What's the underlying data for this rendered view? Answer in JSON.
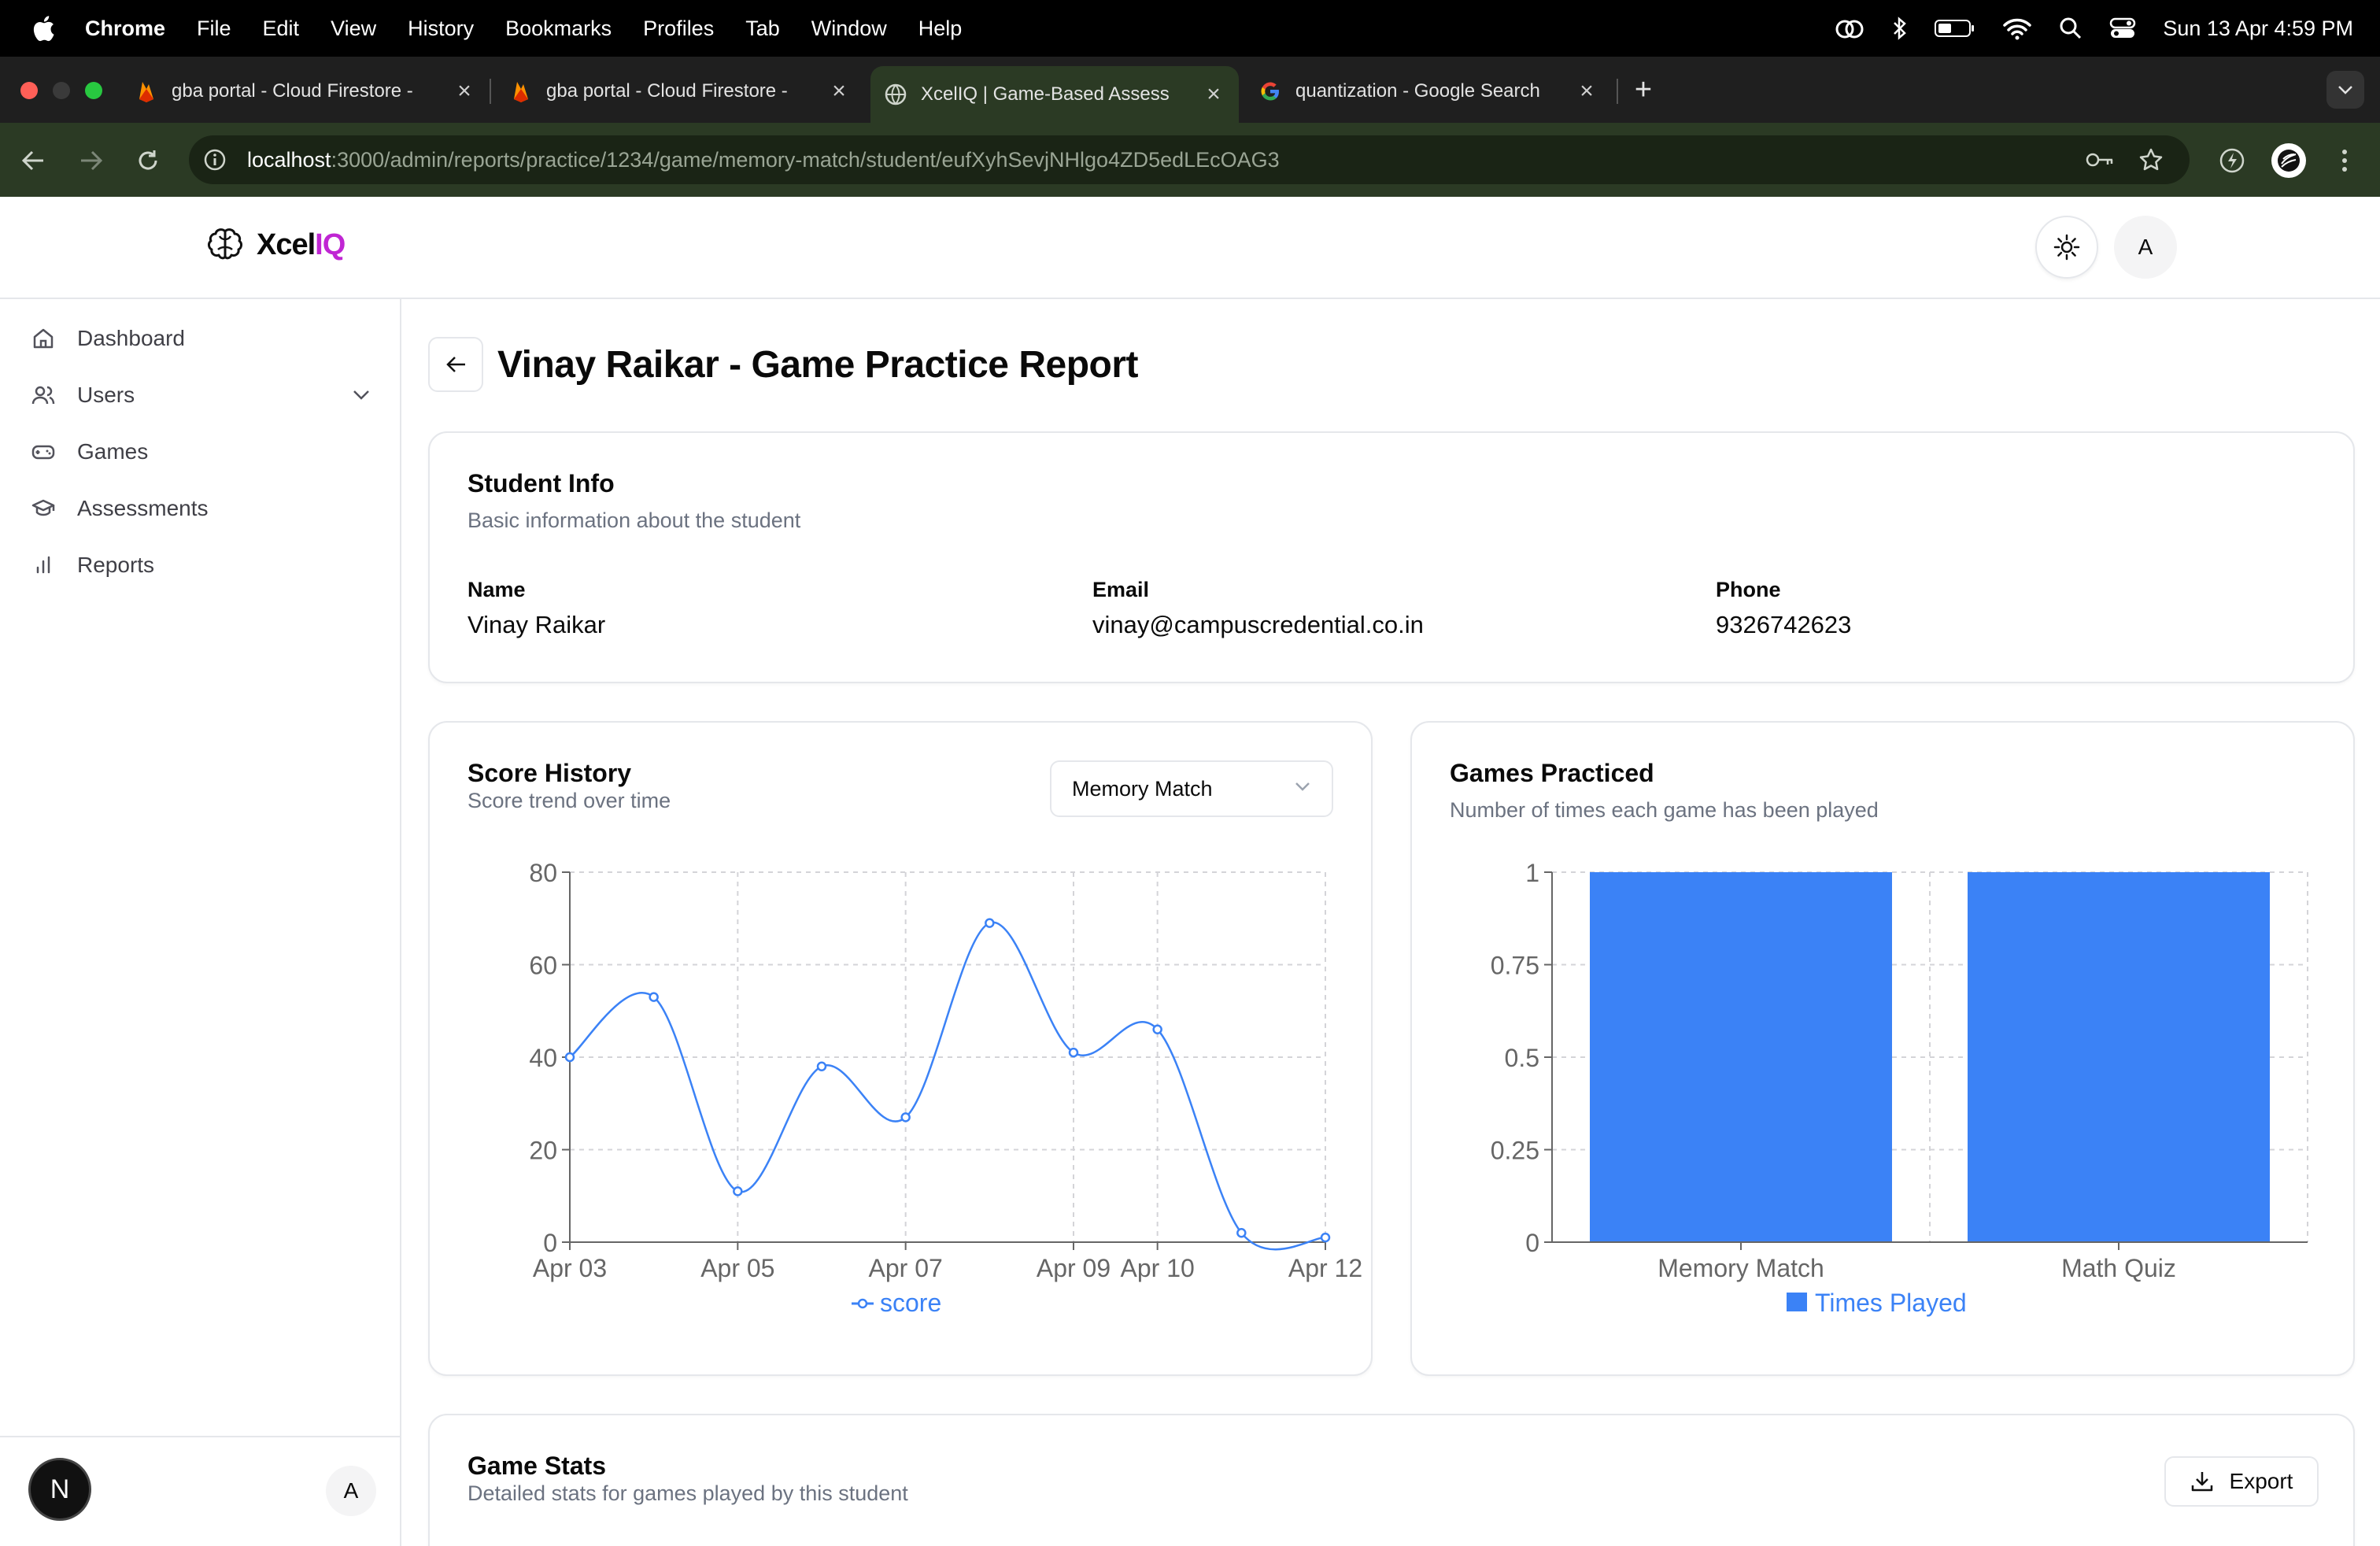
{
  "menubar": {
    "app_name": "Chrome",
    "items": [
      "File",
      "Edit",
      "View",
      "History",
      "Bookmarks",
      "Profiles",
      "Tab",
      "Window",
      "Help"
    ],
    "datetime": "Sun 13 Apr  4:59 PM"
  },
  "browser": {
    "tabs": [
      {
        "title": "gba portal - Cloud Firestore -",
        "icon": "firebase-icon"
      },
      {
        "title": "gba portal - Cloud Firestore -",
        "icon": "firebase-icon"
      },
      {
        "title": "XcelIQ | Game-Based Assess",
        "icon": "globe-icon"
      },
      {
        "title": "quantization - Google Search",
        "icon": "google-icon"
      }
    ],
    "url_host": "localhost",
    "url_path": ":3000/admin/reports/practice/1234/game/memory-match/student/eufXyhSevjNHlgo4ZD5edLEcOAG3"
  },
  "header": {
    "logo_text": "Xcel",
    "logo_accent": "IQ",
    "avatar_initial": "A"
  },
  "sidebar": {
    "items": [
      {
        "label": "Dashboard",
        "icon": "home-icon"
      },
      {
        "label": "Users",
        "icon": "users-icon"
      },
      {
        "label": "Games",
        "icon": "gamepad-icon"
      },
      {
        "label": "Assessments",
        "icon": "graduation-cap-icon"
      },
      {
        "label": "Reports",
        "icon": "bar-chart-icon"
      }
    ],
    "footer_badge": "N",
    "footer_avatar": "A"
  },
  "page": {
    "title": "Vinay Raikar - Game Practice Report"
  },
  "student_info": {
    "title": "Student Info",
    "subtitle": "Basic information about the student",
    "name_label": "Name",
    "name": "Vinay Raikar",
    "email_label": "Email",
    "email": "vinay@campuscredential.co.in",
    "phone_label": "Phone",
    "phone": "9326742623"
  },
  "score_history": {
    "title": "Score History",
    "subtitle": "Score trend over time",
    "selected_game": "Memory Match"
  },
  "games_practiced": {
    "title": "Games Practiced",
    "subtitle": "Number of times each game has been played"
  },
  "game_stats": {
    "title": "Game Stats",
    "subtitle": "Detailed stats for games played by this student",
    "export_label": "Export"
  },
  "colors": {
    "accent": "#3b82f6",
    "brand": "#c026d3"
  },
  "chart_data": [
    {
      "type": "line",
      "x": [
        "Apr 03",
        "Apr 04",
        "Apr 05",
        "Apr 06",
        "Apr 07",
        "Apr 08",
        "Apr 09",
        "Apr 10",
        "Apr 11",
        "Apr 12"
      ],
      "x_tick_labels": [
        "Apr 03",
        "Apr 05",
        "Apr 07",
        "Apr 09",
        "Apr 10",
        "Apr 12"
      ],
      "series": [
        {
          "name": "score",
          "values": [
            40,
            53,
            11,
            38,
            27,
            69,
            41,
            46,
            2,
            1
          ]
        }
      ],
      "y_ticks": [
        0,
        20,
        40,
        60,
        80
      ],
      "ylim": [
        0,
        80
      ],
      "grid": true,
      "legend": "bottom"
    },
    {
      "type": "bar",
      "categories": [
        "Memory Match",
        "Math Quiz"
      ],
      "series": [
        {
          "name": "Times Played",
          "values": [
            1,
            1
          ]
        }
      ],
      "y_ticks": [
        "0",
        "0.25",
        "0.5",
        "0.75",
        "1"
      ],
      "ylim": [
        0,
        1
      ],
      "grid": true,
      "legend": "bottom"
    }
  ]
}
